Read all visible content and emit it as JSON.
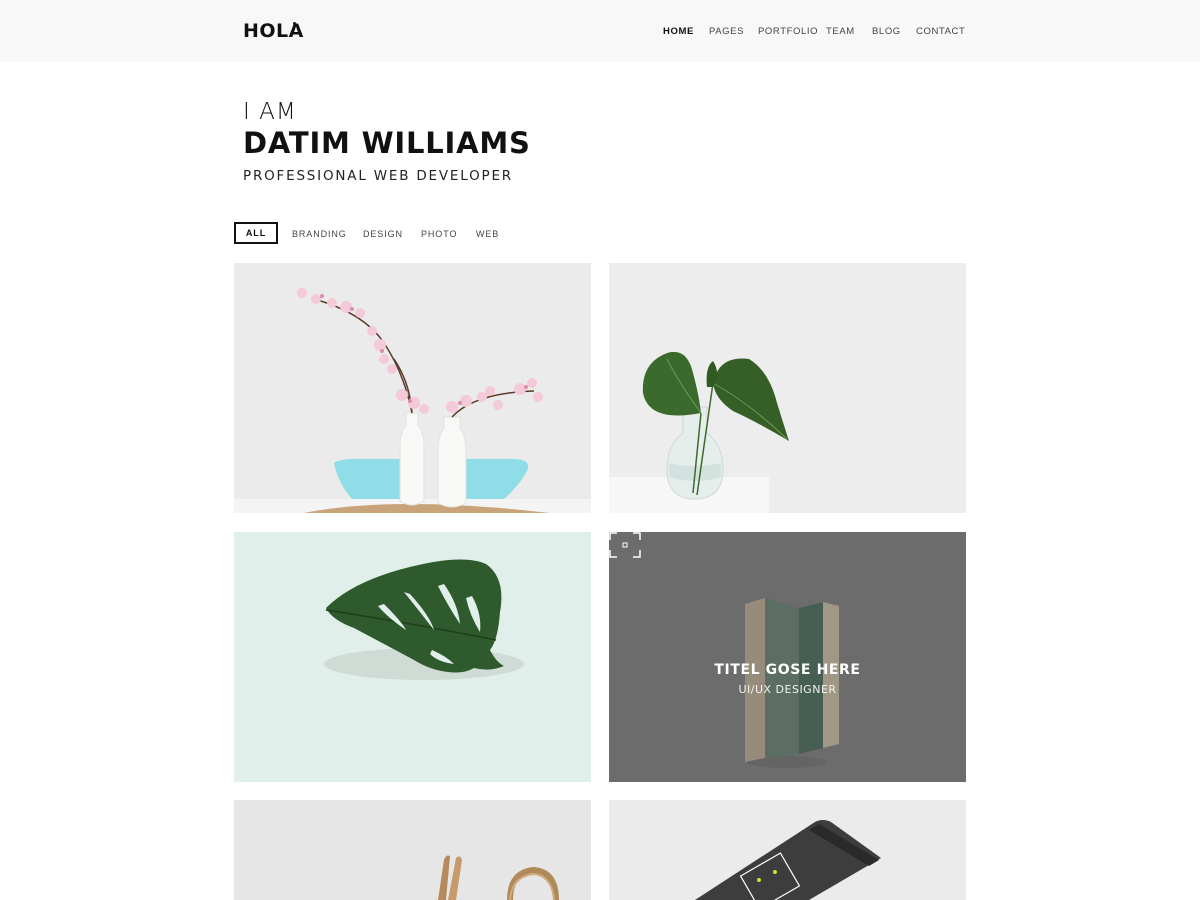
{
  "header": {
    "logo": "HOLA",
    "nav": [
      "HOME",
      "PAGES",
      "PORTFOLIO",
      "TEAM",
      "BLOG",
      "CONTACT"
    ],
    "active": "HOME"
  },
  "hero": {
    "intro": "I AM",
    "name": "DATIM WILLIAMS",
    "role": "PROFESSIONAL WEB DEVELOPER"
  },
  "filters": [
    "ALL",
    "BRANDING",
    "DESIGN",
    "PHOTO",
    "WEB"
  ],
  "portfolio": {
    "hover_item": {
      "title": "TITEL GOSE HERE",
      "subtitle": "UI/UX DESIGNER",
      "icon": "fullscreen-icon"
    },
    "items": [
      {
        "image": "vases-with-blossoms-image"
      },
      {
        "image": "leaf-in-glass-vase-image"
      },
      {
        "image": "monstera-leaf-image"
      },
      {
        "image": "folded-brochure-image"
      },
      {
        "image": "twine-and-sticks-image"
      },
      {
        "image": "business-card-image"
      }
    ]
  },
  "colors": {
    "header_bg": "#f8f8f8",
    "text": "#111111",
    "mint": "#e1efea",
    "overlay_gray": "#777777",
    "leaf_green": "#2f5a2d"
  }
}
